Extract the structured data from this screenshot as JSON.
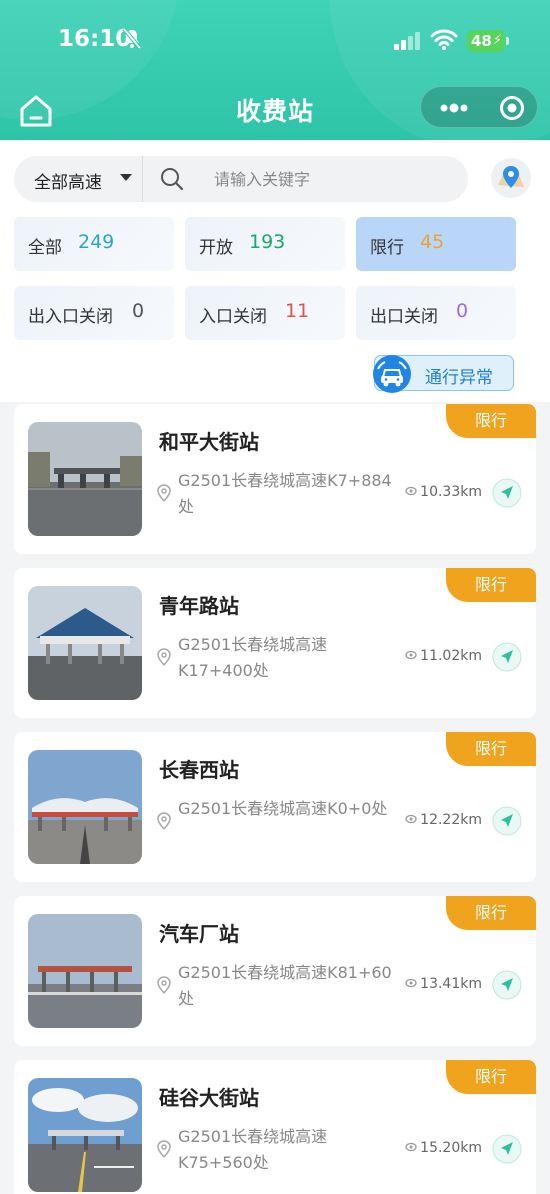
{
  "status_bar": {
    "time": "16:10",
    "battery": "48"
  },
  "nav": {
    "title": "收费站"
  },
  "filter": {
    "highway_select": "全部高速",
    "search_placeholder": "请输入关键字"
  },
  "stats": [
    {
      "label": "全部",
      "value": "249",
      "color": "#2aa6c9"
    },
    {
      "label": "开放",
      "value": "193",
      "color": "#18a870"
    },
    {
      "label": "限行",
      "value": "45",
      "color": "#e8a23a"
    },
    {
      "label": "出入口关闭",
      "value": "0",
      "color": "#555555"
    },
    {
      "label": "入口关闭",
      "value": "11",
      "color": "#e0524a"
    },
    {
      "label": "出口关闭",
      "value": "0",
      "color": "#9b6fd6"
    }
  ],
  "anomaly_button": "通行异常",
  "stations": [
    {
      "name": "和平大街站",
      "address": "G2501长春绕城高速K7+884处",
      "distance": "10.33km",
      "status": "限行"
    },
    {
      "name": "青年路站",
      "address": "G2501长春绕城高速K17+400处",
      "distance": "11.02km",
      "status": "限行"
    },
    {
      "name": "长春西站",
      "address": "G2501长春绕城高速K0+0处",
      "distance": "12.22km",
      "status": "限行"
    },
    {
      "name": "汽车厂站",
      "address": "G2501长春绕城高速K81+60处",
      "distance": "13.41km",
      "status": "限行"
    },
    {
      "name": "硅谷大街站",
      "address": "G2501长春绕城高速K75+560处",
      "distance": "15.20km",
      "status": "限行"
    }
  ]
}
